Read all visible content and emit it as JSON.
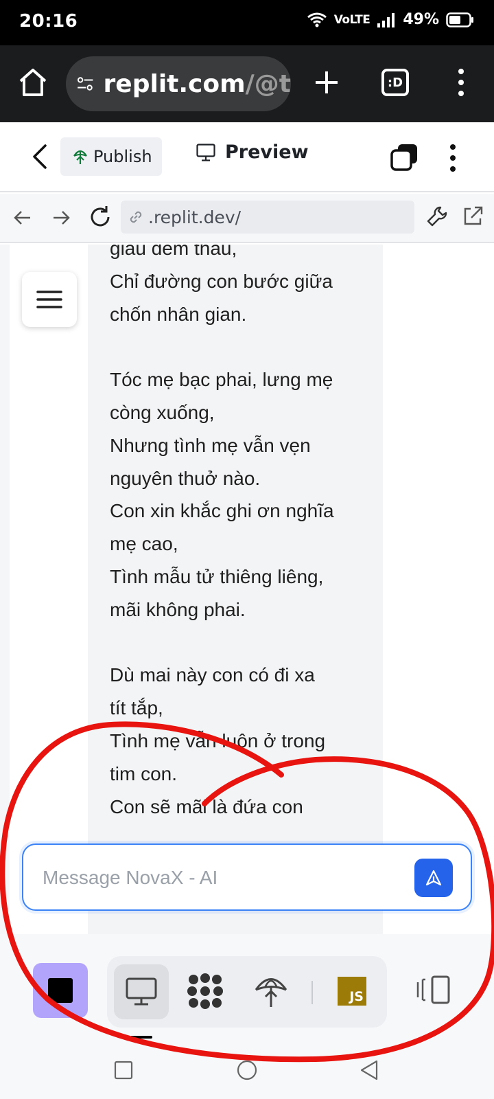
{
  "status_bar": {
    "time": "20:16",
    "network": "VoLTE",
    "battery": "49%"
  },
  "browser": {
    "url_host": "replit.com",
    "url_path": "/@t",
    "tabs_label": ":D"
  },
  "replit_header": {
    "publish_label": "Publish",
    "preview_label": "Preview"
  },
  "webview": {
    "address": ".replit.dev/"
  },
  "poem": {
    "text": "giàu đêm thâu,\nChỉ đường con bước giữa\nchốn nhân gian.\n\nTóc mẹ bạc phai, lưng mẹ\ncòng xuống,\nNhưng tình mẹ vẫn vẹn\nnguyên thuở nào.\nCon xin khắc ghi ơn nghĩa\nmẹ cao,\nTình mẫu tử thiêng liêng,\nmãi không phai.\n\nDù mai này con có đi xa\ntít tắp,\nTình mẹ vẫn luôn ở trong\ntim con.\nCon sẽ mãi là đứa con\n\ntrọng Mẹ trọn đời."
  },
  "message": {
    "placeholder": "Message NovaX - AI",
    "value": ""
  },
  "toolbar": {
    "js_label": "JS"
  },
  "colors": {
    "accent_blue": "#2563eb",
    "stop_purple": "#b3a4fb",
    "annotation_red": "#e8140f",
    "js_badge": "#9c7b08"
  }
}
